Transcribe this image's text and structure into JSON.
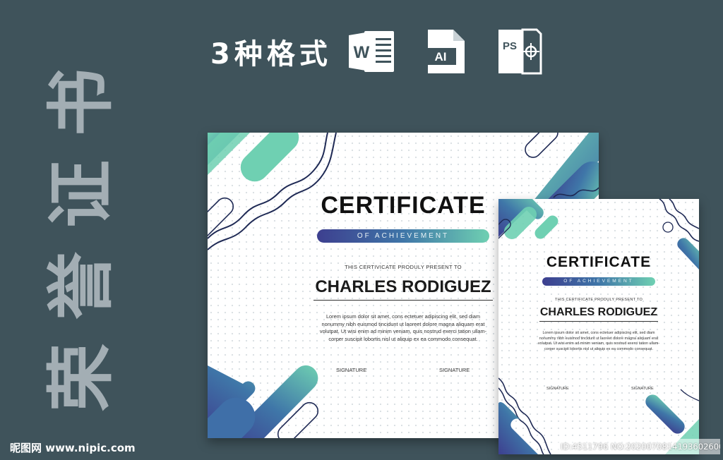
{
  "side_title": [
    "书",
    "证",
    "誉",
    "荣"
  ],
  "formats": {
    "label": "3种格式",
    "icons": [
      {
        "name": "word-doc-icon",
        "text": "W"
      },
      {
        "name": "ai-file-icon",
        "text": "AI"
      },
      {
        "name": "ps-file-icon",
        "text": "PS"
      }
    ]
  },
  "certificate_landscape": {
    "title": "CERTIFICATE",
    "subtitle": "OF ACHIEVEMENT",
    "present_line": "THIS CERTIVICATE PRODULY PRESENT TO",
    "name": "CHARLES RODIGUEZ",
    "body": "Lorem ipsum dolor sit amet, cons ectetuer adipiscing elit, sed diam nonummy nibh euismod tincidunt ut laoreet dolore magna aliquam erat volutpat. Ut wisi enim ad minim veniam, quis nostrud exerci tation ullam-corper suscipit lobortis nisl ut aliquip ex ea commodo consequat.",
    "signature_left": "SIGNATURE",
    "signature_right": "SIGNATURE"
  },
  "certificate_portrait": {
    "title": "CERTIFICATE",
    "subtitle": "OF ACHIEVEMENT",
    "present_line": "THIS CERTIFICATE PRODULY PRESENT TO",
    "name": "CHARLES RODIGUEZ",
    "body": "Lorem ipsum dolor sit amet, cons ectetuer adipiscing elit, sed diam nonummy nibh euismod tincidunt ut laoreet dolore magna aliquam erat volutpat. Ut wisi enim ad minim veniam, quis nostrud exerci tation ullam-corper suscipit lobortis nisl ut aliquip ex ea commodo consequat.",
    "signature_left": "SIGNATURE",
    "signature_right": "SIGNATURE"
  },
  "watermark_left": "昵图网 www.nipic.com",
  "watermark_right": "ID:4511796 NO:20200708141936026000",
  "colors": {
    "background": "#3f535b",
    "gradient_start": "#3d3f8f",
    "gradient_mid": "#3f76a8",
    "gradient_end": "#6fd0b2",
    "line_navy": "#1f2a55"
  }
}
